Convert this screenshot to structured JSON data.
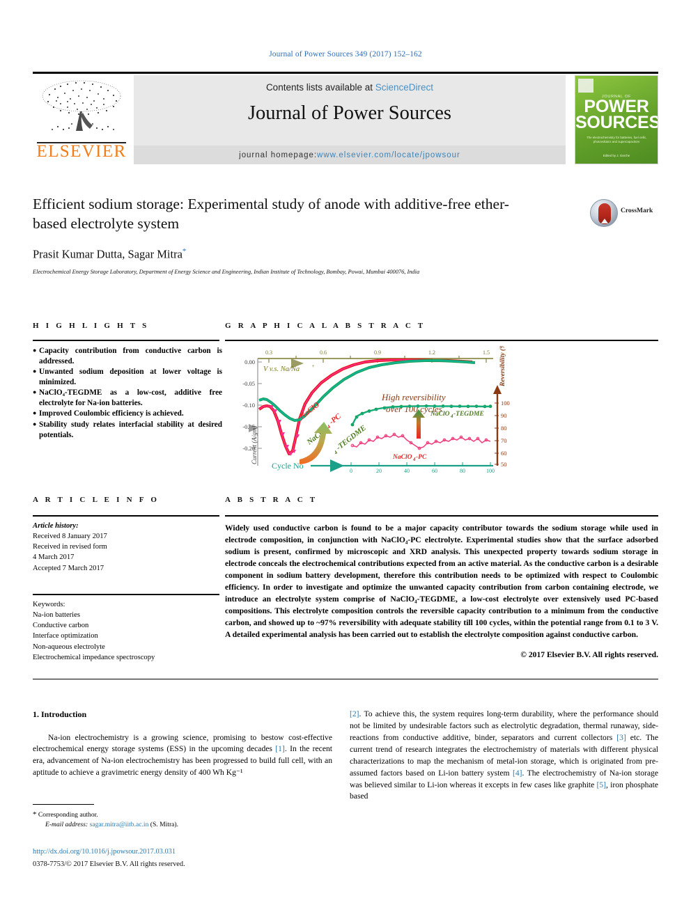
{
  "running_head": "Journal of Power Sources 349 (2017) 152–162",
  "masthead": {
    "contents_prefix": "Contents lists available at ",
    "contents_link": "ScienceDirect",
    "journal_name": "Journal of Power Sources",
    "homepage_prefix": "journal homepage: ",
    "homepage_url": "www.elsevier.com/locate/jpowsour",
    "publisher": "ELSEVIER",
    "cover": {
      "small_top": "JOURNAL OF",
      "title_line1": "POWER",
      "title_line2": "SOURCES",
      "subtitle": "The electrochemistry for\nbatteries, fuel cells, photovoltaics and supercapacitors",
      "footer": "Edited by\nJ. Garche"
    }
  },
  "article": {
    "title": "Efficient sodium storage: Experimental study of anode with additive-free ether-based electrolyte system",
    "authors": "Prasit Kumar Dutta, Sagar Mitra",
    "corresponding_marker": "*",
    "affiliation": "Electrochemical Energy Storage Laboratory, Department of Energy Science and Engineering, Indian Institute of Technology, Bombay, Powai, Mumbai 400076, India",
    "crossmark_label": "CrossMark"
  },
  "highlights": {
    "heading": "H I G H L I G H T S",
    "bullet": "●",
    "items": [
      "Capacity contribution from conductive carbon is addressed.",
      "Unwanted sodium deposition at lower voltage is minimized.",
      "NaClO₄-TEGDME as a low-cost, additive free electrolyte for Na-ion batteries.",
      "Improved Coulombic efficiency is achieved.",
      "Stability study relates interfacial stability at desired potentials."
    ]
  },
  "graphical_abstract": {
    "heading": "G R A P H I C A L  A B S T R A C T"
  },
  "article_info": {
    "heading": "A R T I C L E  I N F O",
    "history_label": "Article history:",
    "history": [
      "Received 8 January 2017",
      "Received in revised form",
      "4 March 2017",
      "Accepted 7 March 2017"
    ],
    "keywords_label": "Keywords:",
    "keywords": [
      "Na-ion batteries",
      "Conductive carbon",
      "Interface optimization",
      "Non-aqueous electrolyte",
      "Electrochemical impedance spectroscopy"
    ]
  },
  "abstract": {
    "heading": "A B S T R A C T",
    "text": "Widely used conductive carbon is found to be a major capacity contributor towards the sodium storage while used in electrode composition, in conjunction with NaClO₄-PC electrolyte. Experimental studies show that the surface adsorbed sodium is present, confirmed by microscopic and XRD analysis. This unexpected property towards sodium storage in electrode conceals the electrochemical contributions expected from an active material. As the conductive carbon is a desirable component in sodium battery development, therefore this contribution needs to be optimized with respect to Coulombic efficiency. In order to investigate and optimize the unwanted capacity contribution from carbon containing electrode, we introduce an electrolyte system comprise of NaClO₄-TEGDME, a low-cost electrolyte over extensively used PC-based compositions. This electrolyte composition controls the reversible capacity contribution to a minimum from the conductive carbon, and showed up to ~97% reversibility with adequate stability till 100 cycles, within the potential range from 0.1 to 3 V. A detailed experimental analysis has been carried out to establish the electrolyte composition against conductive carbon.",
    "copyright": "© 2017 Elsevier B.V. All rights reserved."
  },
  "introduction": {
    "number_title": "1. Introduction",
    "left_paragraph": "Na-ion electrochemistry is a growing science, promising to bestow cost-effective electrochemical energy storage systems (ESS) in the upcoming decades [1]. In the recent era, advancement of Na-ion electrochemistry has been progressed to build full cell, with an aptitude to achieve a gravimetric energy density of 400 Wh Kg⁻¹",
    "right_paragraph": "[2]. To achieve this, the system requires long-term durability, where the performance should not be limited by undesirable factors such as electrolytic degradation, thermal runaway, side-reactions from conductive additive, binder, separators and current collectors [3] etc. The current trend of research integrates the electrochemistry of materials with different physical characterizations to map the mechanism of metal-ion storage, which is originated from pre-assumed factors based on Li-ion battery system [4]. The electrochemistry of Na-ion storage was believed similar to Li-ion whereas it excepts in few cases like graphite [5], iron phosphate based",
    "refs": [
      "[1]",
      "[2]",
      "[3]",
      "[4]",
      "[5]"
    ]
  },
  "footer": {
    "corresponding_star": "*",
    "corresponding_text": "Corresponding author.",
    "email_label": "E-mail address:",
    "email": "sagar.mitra@iitb.ac.in",
    "email_suffix": "(S. Mitra).",
    "doi": "http://dx.doi.org/10.1016/j.jpowsour.2017.03.031",
    "issn_line": "0378-7753/© 2017 Elsevier B.V. All rights reserved."
  },
  "chart_data": {
    "type": "line",
    "title": "",
    "main_plot": {
      "xlabel": "V v.s. Na/Na⁺",
      "xlabel_color": "#7a7a2a",
      "x_ticks": [
        "0.3",
        "0.6",
        "0.9",
        "1.2",
        "1.5"
      ],
      "x_tick_values": [
        0.3,
        0.6,
        0.9,
        1.2,
        1.5
      ],
      "xlim": [
        0.1,
        1.7
      ],
      "ylabel": "Current (A/gm)",
      "ylabel_color": "#808080",
      "y_ticks": [
        "0.00",
        "-0.05",
        "-0.10",
        "-0.15",
        "-0.20"
      ],
      "y_tick_values": [
        0.0,
        -0.05,
        -0.1,
        -0.15,
        -0.2
      ],
      "ylim": [
        -0.235,
        0.012
      ],
      "grid": false,
      "series": [
        {
          "name": "NaClO₄-PC",
          "color": "#e8141e",
          "marker": "triangle-down",
          "label_color": "#ee2222",
          "x": [
            0.12,
            0.16,
            0.2,
            0.24,
            0.28,
            0.32,
            0.36,
            0.4,
            0.44,
            0.48,
            0.52,
            0.56,
            0.62,
            0.7,
            0.8,
            0.92,
            1.05,
            1.18,
            1.3,
            1.42
          ],
          "y": [
            -0.118,
            -0.112,
            -0.11,
            -0.112,
            -0.122,
            -0.145,
            -0.175,
            -0.205,
            -0.222,
            -0.215,
            -0.18,
            -0.14,
            -0.105,
            -0.08,
            -0.058,
            -0.04,
            -0.026,
            -0.016,
            -0.01,
            -0.008
          ]
        },
        {
          "name": "NaClO₄-TEGDME",
          "color": "#15a05a",
          "marker": "circle",
          "label_color": "#4d7a1e",
          "x": [
            0.12,
            0.16,
            0.2,
            0.24,
            0.28,
            0.32,
            0.36,
            0.4,
            0.44,
            0.48,
            0.52,
            0.56,
            0.62,
            0.7,
            0.8,
            0.92,
            1.05,
            1.18,
            1.3,
            1.42
          ],
          "y": [
            -0.101,
            -0.098,
            -0.1,
            -0.106,
            -0.115,
            -0.126,
            -0.136,
            -0.144,
            -0.148,
            -0.146,
            -0.138,
            -0.126,
            -0.11,
            -0.088,
            -0.066,
            -0.046,
            -0.03,
            -0.019,
            -0.012,
            -0.009
          ]
        }
      ]
    },
    "inset_plot": {
      "xlabel": "Cycle No",
      "xlabel_color": "#1aa089",
      "x_ticks": [
        "0",
        "20",
        "40",
        "60",
        "80",
        "100"
      ],
      "x_tick_values": [
        0,
        20,
        40,
        60,
        80,
        100
      ],
      "xlim": [
        -4,
        104
      ],
      "ylabel": "Reversibility (%)",
      "ylabel_color": "#8a3a12",
      "y_ticks": [
        "50",
        "60",
        "70",
        "80",
        "90",
        "100"
      ],
      "y_tick_values": [
        50,
        60,
        70,
        80,
        90,
        100
      ],
      "ylim": [
        50,
        104
      ],
      "series": [
        {
          "name": "NaClO₄-TEGDME",
          "color": "#15a05a",
          "label_color": "#4d7a1e",
          "x": [
            1,
            3,
            5,
            8,
            12,
            16,
            20,
            25,
            30,
            36,
            42,
            48,
            55,
            62,
            70,
            78,
            86,
            94,
            100
          ],
          "y": [
            84,
            88,
            90.5,
            92,
            93.5,
            94.5,
            95.2,
            95.8,
            96.2,
            96.4,
            96.6,
            96.7,
            96.8,
            96.6,
            96.7,
            96.5,
            96.6,
            96.4,
            96.5
          ]
        },
        {
          "name": "NaClO₄-PC",
          "color": "#ef3d7c",
          "label_color": "#ee2222",
          "x": [
            1,
            4,
            7,
            10,
            13,
            16,
            19,
            22,
            25,
            28,
            31,
            34,
            37,
            40,
            43,
            46,
            49,
            52,
            55,
            58,
            61,
            64,
            67,
            70,
            73,
            76,
            79,
            82,
            85,
            88,
            91,
            94,
            97,
            100
          ],
          "y": [
            68,
            67,
            70,
            69,
            72,
            71,
            74,
            73,
            75,
            74,
            76,
            74,
            75,
            72,
            70,
            68,
            66,
            67,
            70,
            69,
            71,
            70,
            72,
            71,
            73,
            72,
            74,
            72,
            73,
            71,
            73,
            70,
            72,
            71
          ]
        }
      ]
    },
    "annotations": [
      {
        "text": "High reversibility",
        "color": "#8a3a12"
      },
      {
        "text": "over 100 cycles",
        "color": "#8a3a12"
      }
    ]
  }
}
